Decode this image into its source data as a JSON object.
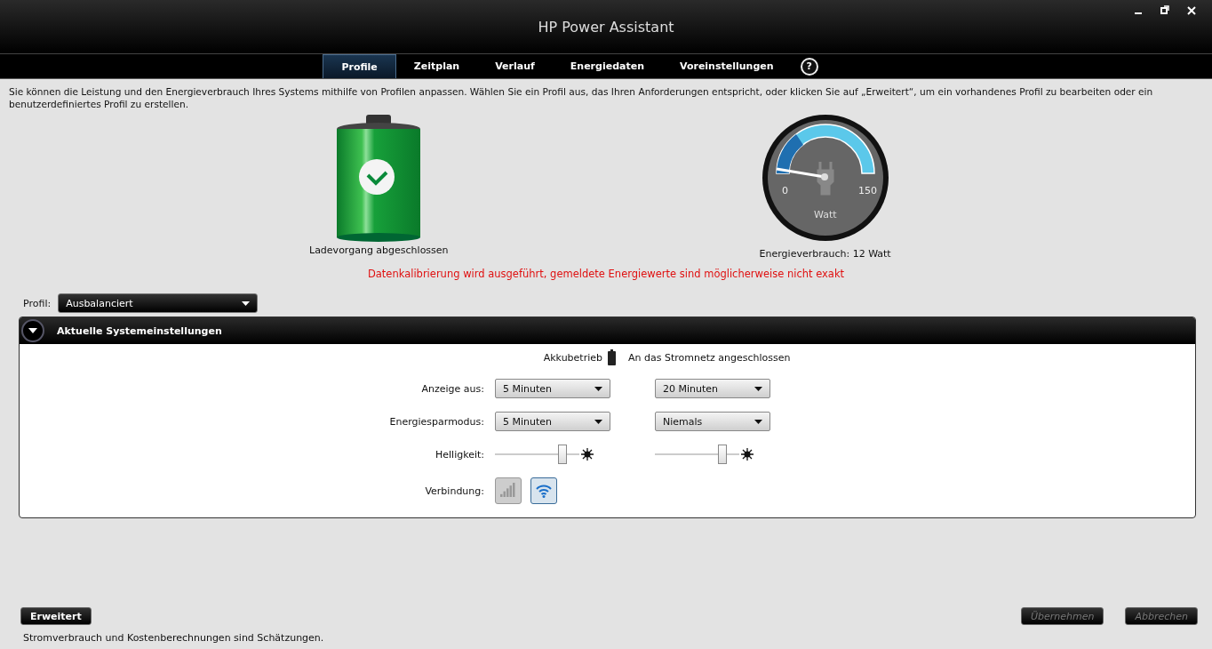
{
  "window": {
    "title": "HP Power Assistant"
  },
  "tabs": [
    {
      "label": "Profile",
      "selected": true
    },
    {
      "label": "Zeitplan",
      "selected": false
    },
    {
      "label": "Verlauf",
      "selected": false
    },
    {
      "label": "Energiedaten",
      "selected": false
    },
    {
      "label": "Voreinstellungen",
      "selected": false
    }
  ],
  "help": "?",
  "intro": "Sie können die Leistung und den Energieverbrauch Ihres Systems mithilfe von Profilen anpassen.  Wählen Sie ein Profil aus, das Ihren Anforderungen entspricht, oder klicken Sie auf „Erweitert“, um ein vorhandenes Profil zu bearbeiten oder ein benutzerdefiniertes Profil zu erstellen.",
  "battery": {
    "caption": "Ladevorgang abgeschlossen"
  },
  "gauge": {
    "min": "0",
    "max": "150",
    "unit": "Watt",
    "caption": "Energieverbrauch: 12 Watt"
  },
  "warning": "Datenkalibrierung wird ausgeführt, gemeldete Energiewerte sind möglicherweise nicht exakt",
  "profile": {
    "label": "Profil:",
    "value": "Ausbalanciert"
  },
  "panel": {
    "title": "Aktuelle Systemeinstellungen",
    "expanded": true,
    "columns": [
      "Akkubetrieb",
      "An das Stromnetz angeschlossen"
    ],
    "rows": [
      {
        "kind": "dropdown",
        "label": "Anzeige aus:",
        "values": [
          "5 Minuten",
          "20 Minuten"
        ]
      },
      {
        "kind": "dropdown",
        "label": "Energiesparmodus:",
        "values": [
          "5 Minuten",
          "Niemals"
        ]
      },
      {
        "kind": "slider",
        "label": "Helligkeit:",
        "levels": [
          {
            "level": 0.8
          },
          {
            "level": 0.8
          }
        ]
      },
      {
        "kind": "toggles",
        "label": "Verbindung:",
        "toggles": [
          {
            "kind": "mobile",
            "on": false
          },
          {
            "kind": "wifi",
            "on": true
          }
        ]
      }
    ]
  },
  "buttons": [
    {
      "label": "Erweitert",
      "disabled": false
    },
    {
      "label": "Übernehmen",
      "disabled": true
    },
    {
      "label": "Abbrechen",
      "disabled": true
    }
  ],
  "footnote": "Stromverbrauch und Kostenberechnungen sind Schätzungen."
}
